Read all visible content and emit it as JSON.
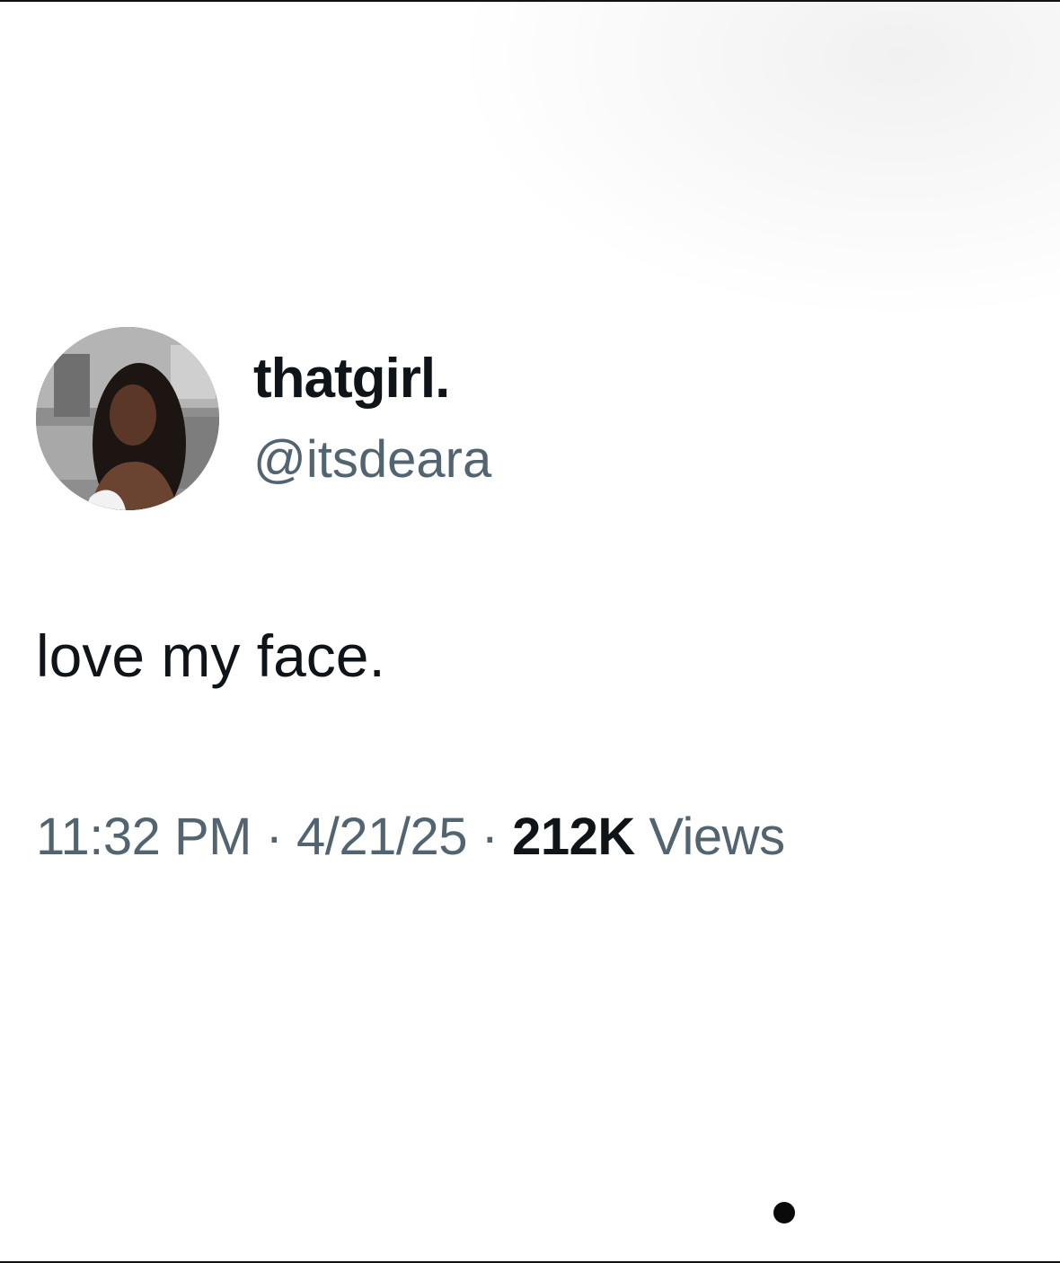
{
  "tweet": {
    "display_name": "thatgirl.",
    "handle": "@itsdeara",
    "text": "love my face.",
    "time": "11:32 PM",
    "separator": "·",
    "date": "4/21/25",
    "views_count": "212K",
    "views_label": "Views"
  },
  "colors": {
    "primary_text": "#0f1419",
    "secondary_text": "#536471",
    "background": "#ffffff"
  }
}
